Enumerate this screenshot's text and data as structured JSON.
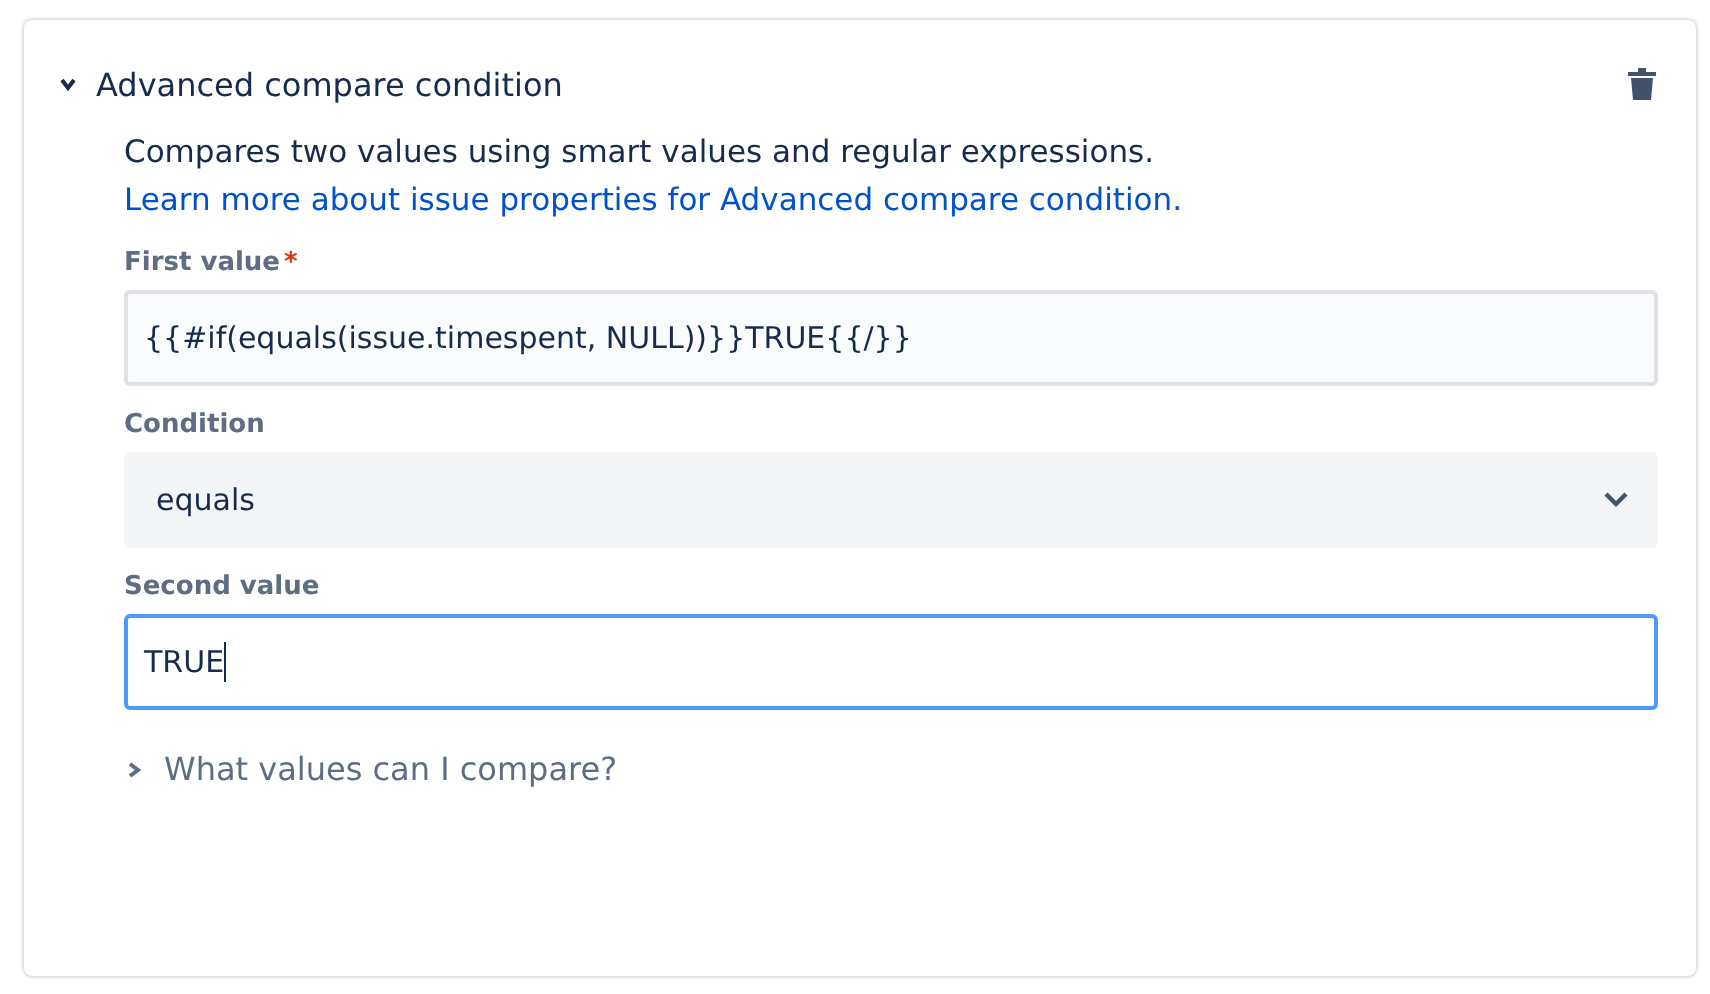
{
  "panel": {
    "title": "Advanced compare condition",
    "expanded": true,
    "description": {
      "text": "Compares two values using smart values and regular expressions.",
      "link": "Learn more about issue properties for Advanced compare condition."
    },
    "fields": [
      {
        "kind": "text",
        "label": "First value",
        "required_marker": "*",
        "value": "{{#if(equals(issue.timespent, NULL))}}TRUE{{/}}",
        "focused": false
      },
      {
        "kind": "select",
        "label": "Condition",
        "value": "equals",
        "focused": false
      },
      {
        "kind": "text",
        "label": "Second value",
        "value": "TRUE",
        "focused": true
      }
    ],
    "help": {
      "label": "What values can I compare?",
      "expanded": false
    }
  }
}
